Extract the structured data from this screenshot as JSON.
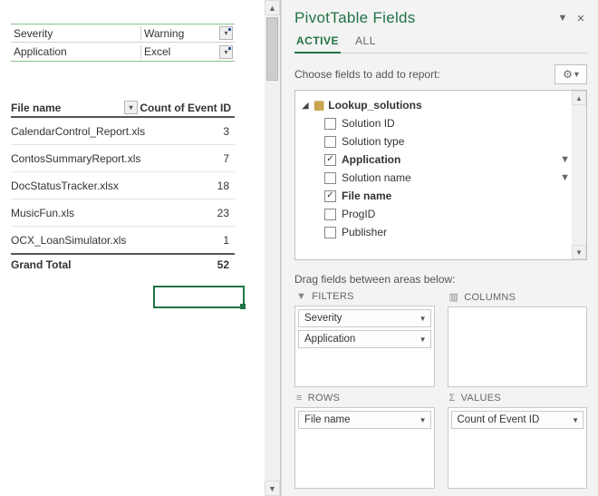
{
  "filters": {
    "rows": [
      {
        "label": "Severity",
        "value": "Warning"
      },
      {
        "label": "Application",
        "value": "Excel"
      }
    ]
  },
  "pivot": {
    "row_header": "File name",
    "value_header": "Count of Event ID",
    "rows": [
      {
        "name": "CalendarControl_Report.xls",
        "value": "3"
      },
      {
        "name": "ContosSummaryReport.xls",
        "value": "7"
      },
      {
        "name": "DocStatusTracker.xlsx",
        "value": "18"
      },
      {
        "name": "MusicFun.xls",
        "value": "23"
      },
      {
        "name": "OCX_LoanSimulator.xls",
        "value": "1"
      }
    ],
    "total_label": "Grand Total",
    "total_value": "52"
  },
  "pane": {
    "title": "PivotTable Fields",
    "tabs": {
      "active": "ACTIVE",
      "all": "ALL"
    },
    "choose_label": "Choose fields to add to report:",
    "table_name": "Lookup_solutions",
    "fields": [
      {
        "name": "Solution ID",
        "checked": false,
        "bold": false,
        "filter": false
      },
      {
        "name": "Solution type",
        "checked": false,
        "bold": false,
        "filter": false
      },
      {
        "name": "Application",
        "checked": true,
        "bold": true,
        "filter": true
      },
      {
        "name": "Solution name",
        "checked": false,
        "bold": false,
        "filter": true
      },
      {
        "name": "File name",
        "checked": true,
        "bold": true,
        "filter": false
      },
      {
        "name": "ProgID",
        "checked": false,
        "bold": false,
        "filter": false
      },
      {
        "name": "Publisher",
        "checked": false,
        "bold": false,
        "filter": false
      }
    ],
    "drag_hint": "Drag fields between areas below:",
    "areas": {
      "filters_label": "FILTERS",
      "columns_label": "COLUMNS",
      "rows_label": "ROWS",
      "values_label": "VALUES",
      "filters": [
        "Severity",
        "Application"
      ],
      "columns": [],
      "rows": [
        "File name"
      ],
      "values": [
        "Count of Event ID"
      ]
    }
  }
}
